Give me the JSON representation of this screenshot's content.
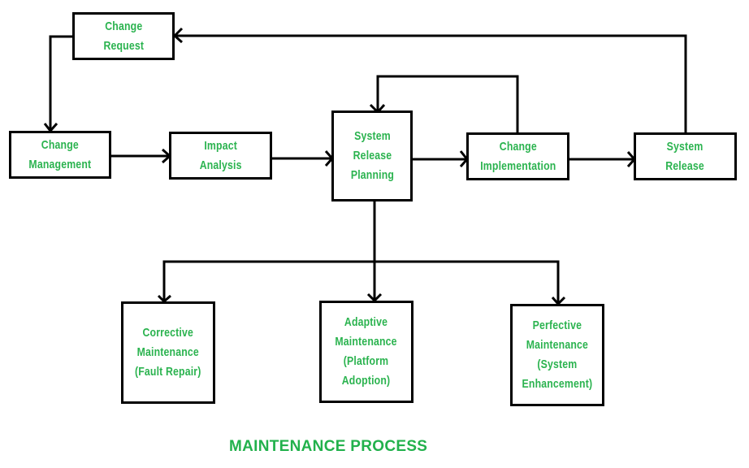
{
  "title": "MAINTENANCE PROCESS",
  "colors": {
    "label": "#2bb34f",
    "title": "#22b14c",
    "stroke": "#000000",
    "background": "#ffffff"
  },
  "nodes": {
    "change_request": "Change\nRequest",
    "change_management": "Change\nManagement",
    "impact_analysis": "Impact\nAnalysis",
    "system_release_planning": "System\nRelease\nPlanning",
    "change_implementation": "Change\nImplementation",
    "system_release": "System\nRelease",
    "corrective_maintenance": "Corrective\nMaintenance\n(Fault Repair)",
    "adaptive_maintenance": "Adaptive\nMaintenance\n(Platform\nAdoption)",
    "perfective_maintenance": "Perfective\nMaintenance\n(System\nEnhancement)"
  },
  "edges": [
    {
      "from": "change_request",
      "to": "change_management"
    },
    {
      "from": "change_management",
      "to": "impact_analysis"
    },
    {
      "from": "impact_analysis",
      "to": "system_release_planning"
    },
    {
      "from": "system_release_planning",
      "to": "change_implementation"
    },
    {
      "from": "change_implementation",
      "to": "system_release_planning"
    },
    {
      "from": "change_implementation",
      "to": "system_release"
    },
    {
      "from": "system_release",
      "to": "change_request"
    },
    {
      "from": "system_release_planning",
      "to": "corrective_maintenance"
    },
    {
      "from": "system_release_planning",
      "to": "adaptive_maintenance"
    },
    {
      "from": "system_release_planning",
      "to": "perfective_maintenance"
    }
  ]
}
